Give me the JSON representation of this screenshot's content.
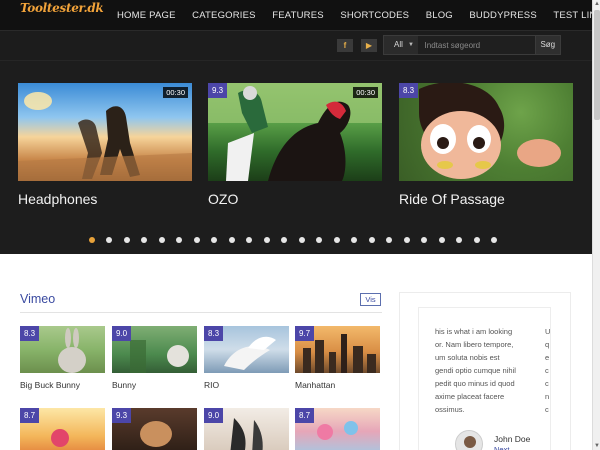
{
  "brand": {
    "logo": "Tooltester.dk",
    "logo_color": "#f2a33a"
  },
  "nav": {
    "items": [
      "HOME PAGE",
      "CATEGORIES",
      "FEATURES",
      "SHORTCODES",
      "BLOG",
      "BUDDYPRESS",
      "TEST LINKS"
    ]
  },
  "subbar": {
    "social": [
      {
        "icon": "facebook-icon",
        "glyph": "f"
      },
      {
        "icon": "youtube-icon",
        "glyph": "▶"
      }
    ],
    "search": {
      "category": "All",
      "placeholder": "Indtast søgeord",
      "button": "Søg"
    }
  },
  "slider": {
    "slides": [
      {
        "title": "Headphones",
        "duration": "00:30",
        "rating": ""
      },
      {
        "title": "OZO",
        "duration": "00:30",
        "rating": "9.3"
      },
      {
        "title": "Ride Of Passage",
        "duration": "",
        "rating": "8.3"
      }
    ],
    "dot_count": 24,
    "active_dot": 0
  },
  "vimeo": {
    "title": "Vimeo",
    "view_all": "Vis",
    "items": [
      {
        "label": "Big Buck Bunny",
        "rating": "8.3"
      },
      {
        "label": "Bunny",
        "rating": "9.0"
      },
      {
        "label": "RIO",
        "rating": "8.3"
      },
      {
        "label": "Manhattan",
        "rating": "9.7"
      },
      {
        "label": "",
        "rating": "8.7"
      },
      {
        "label": "",
        "rating": "9.3"
      },
      {
        "label": "",
        "rating": "9.0"
      },
      {
        "label": "",
        "rating": "8.7"
      }
    ]
  },
  "testimonial": {
    "text": "his is what i am looking\nor. Nam libero tempore,\num soluta nobis est\ngendi optio cumque nihil\npedit quo minus id quod\naxime placeat facere\nossimus.",
    "peek": "U\nq\ne\nc\nc\nn\nc",
    "author": "John Doe",
    "role": "Next\nGeneration"
  },
  "colors": {
    "accent": "#4c46a8",
    "dot_active": "#e8a23a",
    "section_title": "#3a4aa0"
  }
}
